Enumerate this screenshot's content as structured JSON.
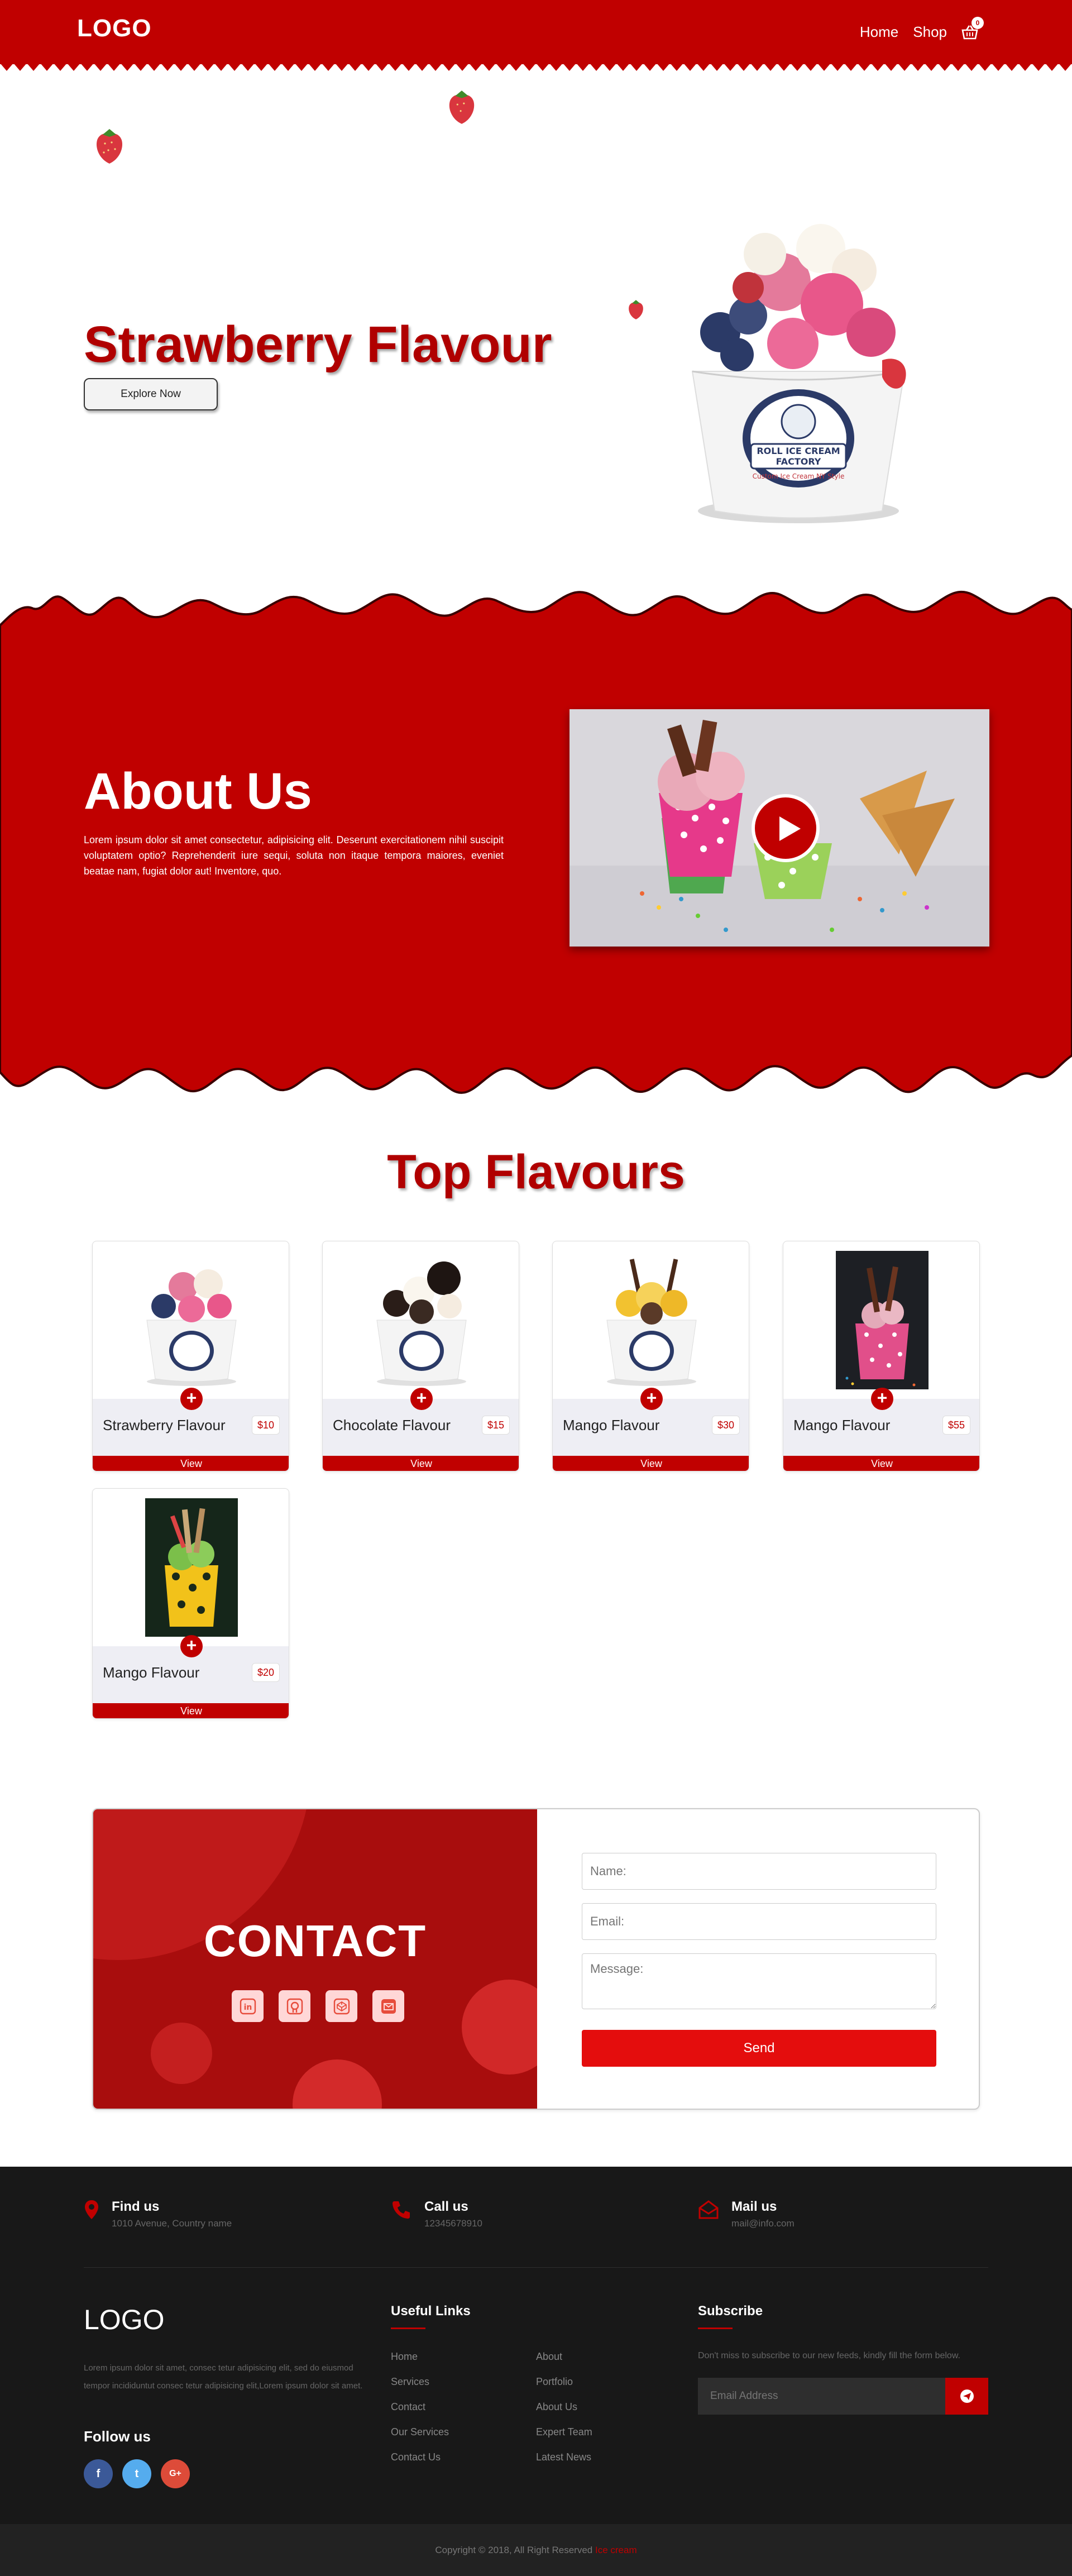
{
  "header": {
    "logo": "LOGO",
    "nav": [
      {
        "label": "Home"
      },
      {
        "label": "Shop"
      }
    ],
    "cart_count": "0",
    "cart_icon": "basket-icon"
  },
  "hero": {
    "title": "Strawberry Flavour",
    "button_label": "Explore Now",
    "cup_text_1": "ROLL ICE CREAM",
    "cup_text_2": "FACTORY",
    "cup_text_3": "Custom Ice Cream NY Style"
  },
  "about": {
    "title": "About Us",
    "text": "Lorem ipsum dolor sit amet consectetur, adipisicing elit. Deserunt exercitationem nihil suscipit voluptatem optio? Reprehenderit iure sequi, soluta non itaque tempora maiores, eveniet beatae nam, fugiat dolor aut! Inventore, quo.",
    "video_icon": "play-icon"
  },
  "flavours": {
    "title": "Top Flavours",
    "items": [
      {
        "name": "Strawberry Flavour",
        "price": "$10",
        "view": "View"
      },
      {
        "name": "Chocolate Flavour",
        "price": "$15",
        "view": "View"
      },
      {
        "name": "Mango Flavour",
        "price": "$30",
        "view": "View"
      },
      {
        "name": "Mango Flavour",
        "price": "$55",
        "view": "View"
      },
      {
        "name": "Mango Flavour",
        "price": "$20",
        "view": "View"
      }
    ]
  },
  "contact": {
    "title": "CONTACT",
    "socials": [
      "linkedin-icon",
      "github-icon",
      "codepen-icon",
      "mail-icon"
    ],
    "name_placeholder": "Name:",
    "email_placeholder": "Email:",
    "message_placeholder": "Message:",
    "send_label": "Send"
  },
  "footer": {
    "info": [
      {
        "title": "Find us",
        "text": "1010 Avenue, Country name",
        "icon": "map-pin-icon"
      },
      {
        "title": "Call us",
        "text": "12345678910",
        "icon": "phone-icon"
      },
      {
        "title": "Mail us",
        "text": "mail@info.com",
        "icon": "envelope-open-icon"
      }
    ],
    "logo": "LOGO",
    "about": "Lorem ipsum dolor sit amet, consec tetur adipisicing elit, sed do eiusmod tempor incididuntut consec tetur adipisicing elit,Lorem ipsum dolor sit amet.",
    "follow": "Follow us",
    "social": [
      {
        "label": "f",
        "icon": "facebook-icon",
        "color": "#3b5998"
      },
      {
        "label": "t",
        "icon": "twitter-icon",
        "color": "#55acee"
      },
      {
        "label": "G+",
        "icon": "google-plus-icon",
        "color": "#dd4b39"
      }
    ],
    "links_title": "Useful Links",
    "links_col1": [
      "Home",
      "Services",
      "Contact",
      "Our Services",
      "Contact Us"
    ],
    "links_col2": [
      "About",
      "Portfolio",
      "About Us",
      "Expert Team",
      "Latest News"
    ],
    "subscribe_title": "Subscribe",
    "subscribe_text": "Don't miss to subscribe to our new feeds, kindly fill the form below.",
    "email_placeholder": "Email Address",
    "copyright": "Copyright © 2018, All Right Reserved",
    "copyright_accent": "Ice cream"
  },
  "colors": {
    "brand_red": "#c00000",
    "footer_bg": "#181818"
  }
}
